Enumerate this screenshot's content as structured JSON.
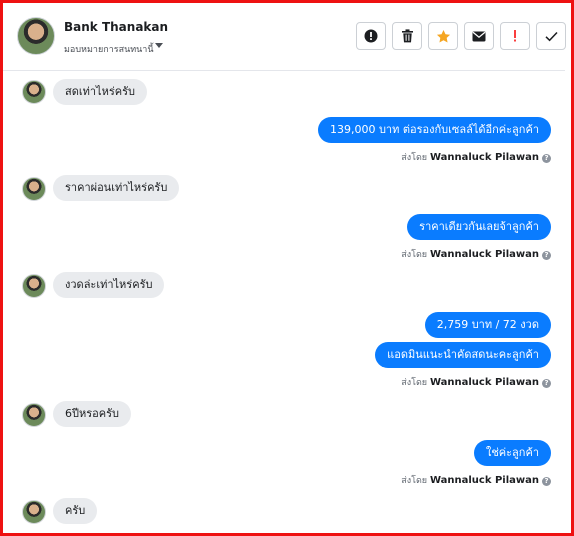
{
  "header": {
    "contact_name": "Bank Thanakan",
    "assign_label": "มอบหมายการสนทนานี้"
  },
  "toolbar": {
    "buttons": [
      {
        "name": "report-spam-button",
        "icon": "alert-circle-icon"
      },
      {
        "name": "delete-button",
        "icon": "trash-icon"
      },
      {
        "name": "star-button",
        "icon": "star-icon",
        "color": "#f5a623"
      },
      {
        "name": "mark-unread-button",
        "icon": "envelope-icon"
      },
      {
        "name": "follow-up-button",
        "icon": "exclamation-icon",
        "color": "#fa3e3e"
      },
      {
        "name": "mark-done-button",
        "icon": "checkmark-icon"
      }
    ]
  },
  "messages": {
    "m1": "สดเท่าไหร่ครับ",
    "m2": "139,000 บาท  ต่อรองกับเซลล์ได้อีกค่ะลูกค้า",
    "m3": "ราคาผ่อนเท่าไหร่ครับ",
    "m4": "ราคาเดียวกันเลยจ้าลูกค้า",
    "m5": "งวดล่ะเท่าไหร่ครับ",
    "m6": "2,759 บาท / 72 งวด",
    "m7": "แอดมินแนะนำคัดสดนะคะลูกค้า",
    "m8": "6ปีหรอครับ",
    "m9": "ใช่ค่ะลูกค้า",
    "m10": "ครับ"
  },
  "sent_by": {
    "prefix": "ส่งโดย",
    "agent": "Wannaluck Pilawan",
    "help": "?"
  },
  "colors": {
    "outgoing_bubble": "#0a7cff",
    "incoming_bubble": "#e9ebee",
    "frame_border": "#ee1111"
  }
}
